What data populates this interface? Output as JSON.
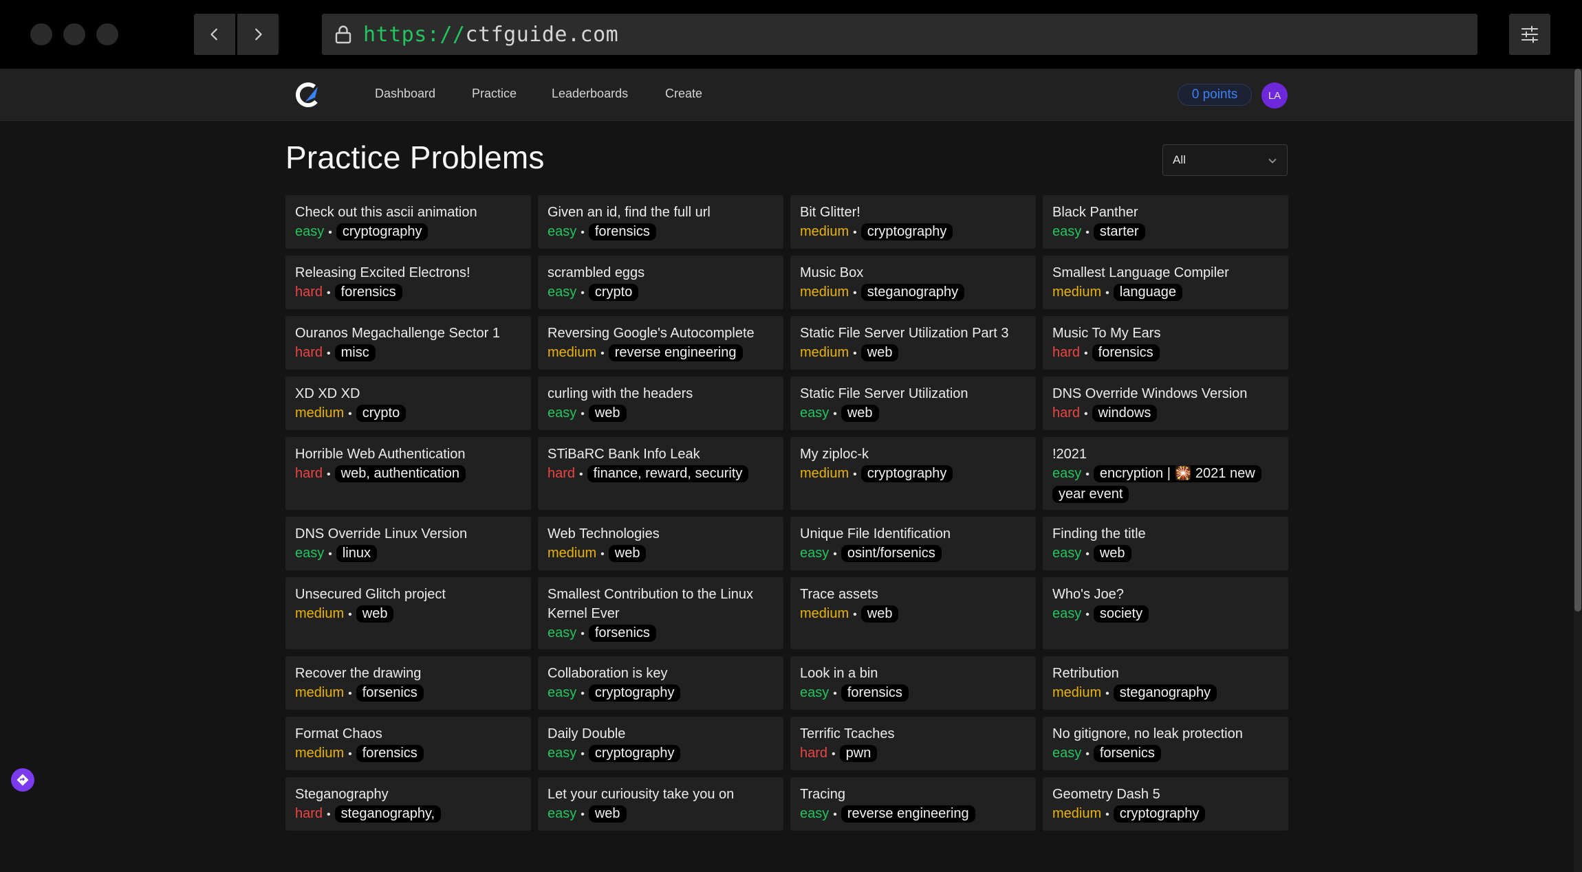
{
  "browser": {
    "url_scheme": "https://",
    "url_host": "ctfguide.com"
  },
  "nav": {
    "links": [
      "Dashboard",
      "Practice",
      "Leaderboards",
      "Create"
    ],
    "points": "0 points",
    "avatar_initials": "LA"
  },
  "page": {
    "title": "Practice Problems",
    "filter_value": "All"
  },
  "colors": {
    "easy": "#22c55e",
    "medium": "#eab308",
    "hard": "#ef4444",
    "points": "#3b82f6",
    "avatar": "#6d28d9"
  },
  "problems": [
    {
      "title": "Check out this ascii animation",
      "difficulty": "easy",
      "tags": "cryptography"
    },
    {
      "title": "Given an id, find the full url",
      "difficulty": "easy",
      "tags": "forensics"
    },
    {
      "title": "Bit Glitter!",
      "difficulty": "medium",
      "tags": "cryptography"
    },
    {
      "title": "Black Panther",
      "difficulty": "easy",
      "tags": "starter"
    },
    {
      "title": "Releasing Excited Electrons!",
      "difficulty": "hard",
      "tags": "forensics"
    },
    {
      "title": "scrambled eggs",
      "difficulty": "easy",
      "tags": "crypto"
    },
    {
      "title": "Music Box",
      "difficulty": "medium",
      "tags": "steganography"
    },
    {
      "title": "Smallest Language Compiler",
      "difficulty": "medium",
      "tags": "language"
    },
    {
      "title": "Ouranos Megachallenge Sector 1",
      "difficulty": "hard",
      "tags": "misc"
    },
    {
      "title": "Reversing Google's Autocomplete",
      "difficulty": "medium",
      "tags": "reverse engineering"
    },
    {
      "title": "Static File Server Utilization Part 3",
      "difficulty": "medium",
      "tags": "web"
    },
    {
      "title": "Music To My Ears",
      "difficulty": "hard",
      "tags": "forensics"
    },
    {
      "title": "XD XD XD",
      "difficulty": "medium",
      "tags": "crypto"
    },
    {
      "title": "curling with the headers",
      "difficulty": "easy",
      "tags": "web"
    },
    {
      "title": "Static File Server Utilization",
      "difficulty": "easy",
      "tags": "web"
    },
    {
      "title": "DNS Override Windows Version",
      "difficulty": "hard",
      "tags": "windows"
    },
    {
      "title": "Horrible Web Authentication",
      "difficulty": "hard",
      "tags": "web, authentication"
    },
    {
      "title": "STiBaRC Bank Info Leak",
      "difficulty": "hard",
      "tags": "finance, reward, security"
    },
    {
      "title": "My ziploc-k",
      "difficulty": "medium",
      "tags": "cryptography"
    },
    {
      "title": "!2021",
      "difficulty": "easy",
      "tags": "encryption | 🎇 2021 new year event"
    },
    {
      "title": "DNS Override Linux Version",
      "difficulty": "easy",
      "tags": "linux"
    },
    {
      "title": "Web Technologies",
      "difficulty": "medium",
      "tags": "web"
    },
    {
      "title": "Unique File Identification",
      "difficulty": "easy",
      "tags": "osint/forsenics"
    },
    {
      "title": "Finding the title",
      "difficulty": "easy",
      "tags": "web"
    },
    {
      "title": "Unsecured Glitch project",
      "difficulty": "medium",
      "tags": "web"
    },
    {
      "title": "Smallest Contribution to the Linux Kernel Ever",
      "difficulty": "easy",
      "tags": "forsenics"
    },
    {
      "title": "Trace assets",
      "difficulty": "medium",
      "tags": "web"
    },
    {
      "title": "Who's Joe?",
      "difficulty": "easy",
      "tags": "society"
    },
    {
      "title": "Recover the drawing",
      "difficulty": "medium",
      "tags": "forsenics"
    },
    {
      "title": "Collaboration is key",
      "difficulty": "easy",
      "tags": "cryptography"
    },
    {
      "title": "Look in a bin",
      "difficulty": "easy",
      "tags": "forensics"
    },
    {
      "title": "Retribution",
      "difficulty": "medium",
      "tags": "steganography"
    },
    {
      "title": "Format Chaos",
      "difficulty": "medium",
      "tags": "forensics"
    },
    {
      "title": "Daily Double",
      "difficulty": "easy",
      "tags": "cryptography"
    },
    {
      "title": "Terrific Tcaches",
      "difficulty": "hard",
      "tags": "pwn"
    },
    {
      "title": "No gitignore, no leak protection",
      "difficulty": "easy",
      "tags": "forsenics"
    },
    {
      "title": "Steganography",
      "difficulty": "hard",
      "tags": "steganography,"
    },
    {
      "title": "Let your curiousity take you on",
      "difficulty": "easy",
      "tags": "web"
    },
    {
      "title": "Tracing",
      "difficulty": "easy",
      "tags": "reverse engineering"
    },
    {
      "title": "Geometry Dash 5",
      "difficulty": "medium",
      "tags": "cryptography"
    }
  ]
}
